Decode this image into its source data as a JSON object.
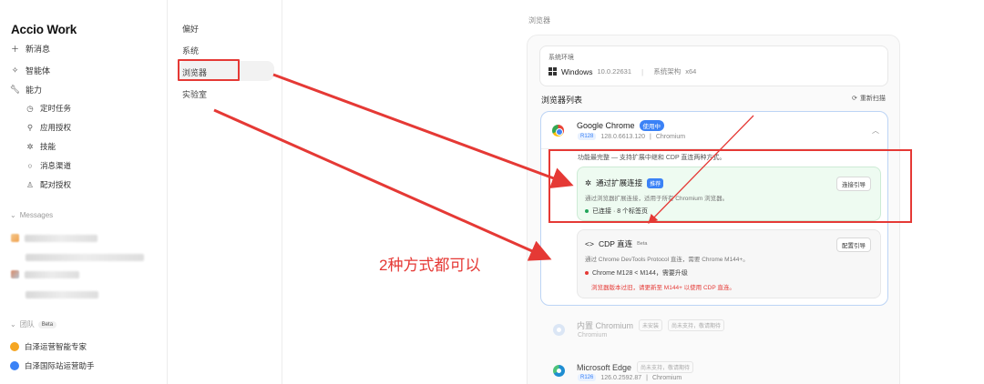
{
  "sidebar": {
    "brand": "Accio Work",
    "new_message": "新消息",
    "agent": "智能体",
    "abilities": "能力",
    "sub_items": [
      "定时任务",
      "应用授权",
      "技能",
      "消息渠道",
      "配对授权"
    ],
    "messages_header": "Messages",
    "team_header": "团队",
    "team_badge": "Beta",
    "team_items": [
      "白泽运营智能专家",
      "白泽国际站运营助手"
    ]
  },
  "settings_menu": {
    "items": [
      "偏好",
      "系统",
      "浏览器",
      "实验室"
    ],
    "active": "浏览器"
  },
  "main": {
    "page_label": "浏览器",
    "env": {
      "title": "系统环境",
      "os": "Windows",
      "os_version": "10.0.22631",
      "arch_label": "系统架构",
      "arch": "x64"
    },
    "list_title": "浏览器列表",
    "rescan_label": "重新扫描",
    "chrome": {
      "name": "Google Chrome",
      "badge": "使用中",
      "version_tag": "R128",
      "version": "128.0.6613.120",
      "engine": "Chromium",
      "feature_text": "功能最完整 — 支持扩展中继和 CDP 直连两种方式。",
      "ext": {
        "title": "通过扩展连接",
        "badge": "推荐",
        "desc": "通过浏览器扩展连接，适用于所有 Chromium 浏览器。",
        "status": "已连接 · 8 个标签页",
        "button": "连接引导"
      },
      "cdp": {
        "title": "CDP 直连",
        "badge": "Beta",
        "desc": "通过 Chrome DevTools Protocol 直连，需要 Chrome M144+。",
        "warning": "Chrome M128 < M144，需要升级",
        "hint": "浏览器版本过旧，请更新至 M144+ 以使用 CDP 直连。",
        "button": "配置引导"
      }
    },
    "chromium": {
      "name": "内置 Chromium",
      "tags": [
        "未安装",
        "尚未支持，敬请期待"
      ],
      "engine": "Chromium"
    },
    "edge": {
      "name": "Microsoft Edge",
      "tags": [
        "尚未支持，敬请期待"
      ],
      "version_tag": "R126",
      "version": "126.0.2592.87",
      "engine": "Chromium"
    }
  },
  "annotation": "2种方式都可以",
  "colors": {
    "annotation_red": "#e53935",
    "accent_blue": "#3b82f6",
    "connected_green": "#22a55a"
  }
}
